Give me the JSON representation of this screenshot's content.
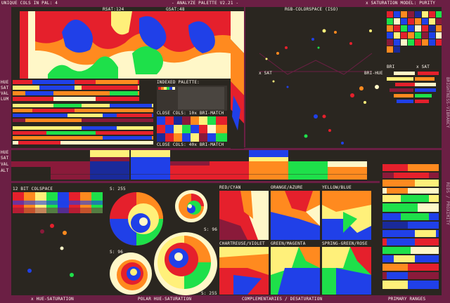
{
  "header": {
    "unique_cols": "UNIQUE COLS IN PAL: 4",
    "rsat": "RSAT:124",
    "gsat": "GSAT:48",
    "title": "- ANALYZE PALETTE V2.21 -",
    "rgb_colorspace": "RGB-COLORSPACE (ISO)",
    "saturation_model": "x SATURATION MODEL: PURITY"
  },
  "left_labels": [
    "HUE",
    "SAT",
    "VAL",
    "LUM"
  ],
  "left_labels2": [
    "HUE",
    "SAT",
    "VAL",
    "ALT"
  ],
  "indexed": {
    "title": "INDEXED PALETTE:",
    "close10": "CLOSE COLS: 10x BRI-MATCH",
    "close40": "CLOSE COLS: 40x BRI-MATCH"
  },
  "colorspace": {
    "xsat_left": "x SAT",
    "bri_hue": "BRI-HUE",
    "bri": "BRI",
    "xsat_right": "x SAT"
  },
  "section_labels": {
    "bit12": "12 BIT COLSPACE",
    "s255_a": "S: 255",
    "s96_a": "S: 96",
    "s96_b": "S: 96",
    "s255_b": "S: 255"
  },
  "complements": [
    "RED/CYAN",
    "ORANGE/AZURE",
    "YELLOW/BLUE",
    "CHARTREUSE/VIOLET",
    "GREEN/MAGENTA",
    "SPRING-GREEN/ROSE"
  ],
  "footer": {
    "hue_sat": "x HUE-SATURATION",
    "polar": "POLAR HUE-SATURATION",
    "complements": "COMPLEMENTARIES / DESATURATION",
    "primary": "PRIMARY RANGES"
  },
  "right_side": {
    "vertical1": "BRIGHTNESS-VIBRANCY",
    "vertical2": "REDS / PROXIMITY"
  },
  "colors": {
    "frame": "#6b1f44",
    "bg": "#2a2620",
    "red": "#e5202c",
    "orange": "#ff8a1f",
    "yellow": "#fff07a",
    "cream": "#fff7c8",
    "green": "#1ee04a",
    "blue": "#2040e8",
    "navy": "#1a2a9a",
    "maroon": "#8a1a3a"
  }
}
